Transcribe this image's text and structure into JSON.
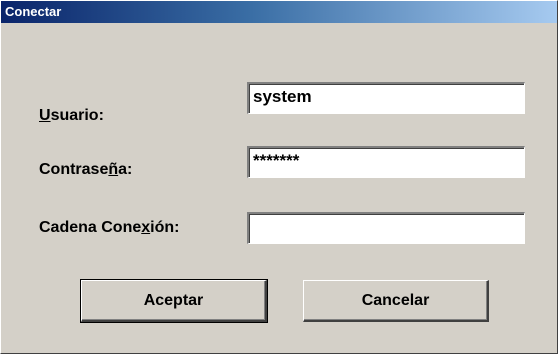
{
  "window": {
    "title": "Conectar"
  },
  "form": {
    "usuario": {
      "label_pre": "",
      "label_mnemonic": "U",
      "label_post": "suario:",
      "value": "system"
    },
    "contrasena": {
      "label_pre": "Contrase",
      "label_mnemonic": "ñ",
      "label_post": "a:",
      "value": "*******"
    },
    "cadena": {
      "label_pre": "Cadena Cone",
      "label_mnemonic": "x",
      "label_post": "ión:",
      "value": ""
    }
  },
  "buttons": {
    "accept": "Aceptar",
    "cancel": "Cancelar"
  }
}
